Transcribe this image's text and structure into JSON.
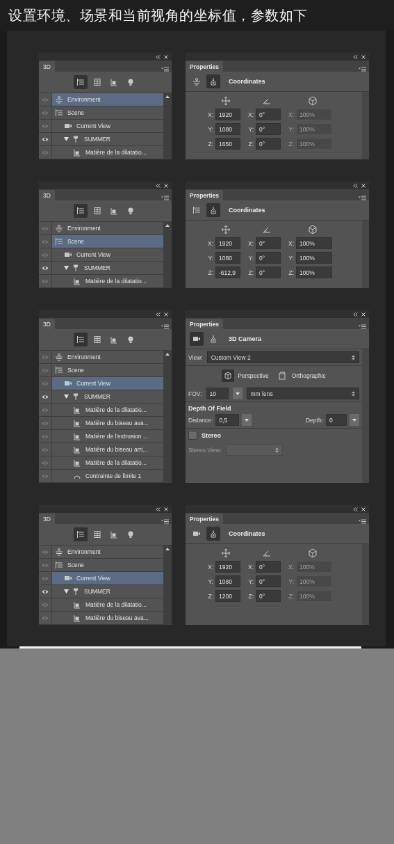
{
  "caption": "设置环境、场景和当前视角的坐标值，参数如下",
  "sections": [
    {
      "layers": {
        "tab": "3D",
        "filters": [
          {
            "kind": "scene",
            "selected": true
          },
          {
            "kind": "mesh",
            "selected": false
          },
          {
            "kind": "material",
            "selected": false
          },
          {
            "kind": "light",
            "selected": false
          }
        ],
        "rows": [
          {
            "kind": "environment",
            "label": "Environment",
            "visible": false,
            "selected": true
          },
          {
            "kind": "scene",
            "label": "Scene",
            "visible": false,
            "selected": false,
            "children": [
              {
                "kind": "camera",
                "label": "Current View",
                "visible": false,
                "selected": false
              },
              {
                "kind": "mesh",
                "label": "SUMMER",
                "visible": true,
                "selected": false,
                "expanded": true,
                "children": [
                  {
                    "kind": "material",
                    "label": "Matière de la dilatatio...",
                    "visible": false,
                    "selected": false
                  }
                ]
              }
            ]
          }
        ]
      },
      "properties": {
        "tab": "Properties",
        "kind": "coordinates",
        "title": "Coordinates",
        "modes": [
          {
            "kind": "environment",
            "selected": false
          },
          {
            "kind": "coordinates",
            "selected": true
          }
        ],
        "rows": [
          {
            "cells": [
              {
                "label": "X:",
                "value": "1920",
                "disabled": false
              },
              {
                "label": "X:",
                "value": "0°",
                "disabled": false
              },
              {
                "label": "X:",
                "value": "100%",
                "disabled": true
              }
            ]
          },
          {
            "cells": [
              {
                "label": "Y:",
                "value": "1080",
                "disabled": false
              },
              {
                "label": "Y:",
                "value": "0°",
                "disabled": false
              },
              {
                "label": "Y:",
                "value": "100%",
                "disabled": true
              }
            ]
          },
          {
            "cells": [
              {
                "label": "Z:",
                "value": "1650",
                "disabled": false
              },
              {
                "label": "Z:",
                "value": "0°",
                "disabled": false
              },
              {
                "label": "Z:",
                "value": "100%",
                "disabled": true
              }
            ]
          }
        ]
      }
    },
    {
      "layers": {
        "tab": "3D",
        "filters": [
          {
            "kind": "scene",
            "selected": true
          },
          {
            "kind": "mesh",
            "selected": false
          },
          {
            "kind": "material",
            "selected": false
          },
          {
            "kind": "light",
            "selected": false
          }
        ],
        "rows": [
          {
            "kind": "environment",
            "label": "Environment",
            "visible": false,
            "selected": false
          },
          {
            "kind": "scene",
            "label": "Scene",
            "visible": false,
            "selected": true,
            "children": [
              {
                "kind": "camera",
                "label": "Current View",
                "visible": false,
                "selected": false
              },
              {
                "kind": "mesh",
                "label": "SUMMER",
                "visible": true,
                "selected": false,
                "expanded": true,
                "children": [
                  {
                    "kind": "material",
                    "label": "Matière de la dilatatio...",
                    "visible": false,
                    "selected": false
                  }
                ]
              }
            ]
          }
        ]
      },
      "properties": {
        "tab": "Properties",
        "kind": "coordinates",
        "title": "Coordinates",
        "modes": [
          {
            "kind": "scene",
            "selected": false
          },
          {
            "kind": "coordinates",
            "selected": true
          }
        ],
        "rows": [
          {
            "cells": [
              {
                "label": "X:",
                "value": "1920",
                "disabled": false
              },
              {
                "label": "X:",
                "value": "0°",
                "disabled": false
              },
              {
                "label": "X:",
                "value": "100%",
                "disabled": false
              }
            ]
          },
          {
            "cells": [
              {
                "label": "Y:",
                "value": "1080",
                "disabled": false
              },
              {
                "label": "Y:",
                "value": "0°",
                "disabled": false
              },
              {
                "label": "Y:",
                "value": "100%",
                "disabled": false
              }
            ]
          },
          {
            "cells": [
              {
                "label": "Z:",
                "value": "-612,9",
                "disabled": false
              },
              {
                "label": "Z:",
                "value": "0°",
                "disabled": false
              },
              {
                "label": "Z:",
                "value": "100%",
                "disabled": false
              }
            ]
          }
        ]
      }
    },
    {
      "layers": {
        "tab": "3D",
        "filters": [
          {
            "kind": "scene",
            "selected": true
          },
          {
            "kind": "mesh",
            "selected": false
          },
          {
            "kind": "material",
            "selected": false
          },
          {
            "kind": "light",
            "selected": false
          }
        ],
        "rows": [
          {
            "kind": "environment",
            "label": "Environment",
            "visible": false,
            "selected": false
          },
          {
            "kind": "scene",
            "label": "Scene",
            "visible": false,
            "selected": false,
            "children": [
              {
                "kind": "camera",
                "label": "Current View",
                "visible": false,
                "selected": true
              },
              {
                "kind": "mesh",
                "label": "SUMMER",
                "visible": true,
                "selected": false,
                "expanded": true,
                "children": [
                  {
                    "kind": "material",
                    "label": "Matière de la dilatatio...",
                    "visible": false,
                    "selected": false
                  },
                  {
                    "kind": "material",
                    "label": "Matière du biseau ava...",
                    "visible": false,
                    "selected": false
                  },
                  {
                    "kind": "material",
                    "label": "Matière de l'extrusion ...",
                    "visible": false,
                    "selected": false
                  },
                  {
                    "kind": "material",
                    "label": "Matière du biseau arri...",
                    "visible": false,
                    "selected": false
                  },
                  {
                    "kind": "material",
                    "label": "Matière de la dilatatio...",
                    "visible": false,
                    "selected": false
                  },
                  {
                    "kind": "constraint",
                    "label": "Contrainte de limite 1",
                    "visible": false,
                    "selected": false
                  }
                ]
              }
            ]
          }
        ]
      },
      "properties": {
        "tab": "Properties",
        "kind": "camera",
        "title": "3D Camera",
        "modes": [
          {
            "kind": "camera",
            "selected": true
          },
          {
            "kind": "coordinates",
            "selected": false
          }
        ],
        "view": {
          "label": "View:",
          "value": "Custom View 2"
        },
        "projections": [
          {
            "kind": "perspective",
            "label": "Perspective",
            "selected": true
          },
          {
            "kind": "orthographic",
            "label": "Orthographic",
            "selected": false
          }
        ],
        "fov": {
          "label": "FOV:",
          "value": "10",
          "lens": "mm lens"
        },
        "dof": {
          "heading": "Depth Of Field",
          "distance": {
            "label": "Distance:",
            "value": "0,5"
          },
          "depth": {
            "label": "Depth:",
            "value": "0"
          }
        },
        "stereo": {
          "label": "Stereo",
          "checked": false,
          "view_label": "Stereo View:",
          "view_disabled": true
        }
      }
    },
    {
      "layers": {
        "tab": "3D",
        "filters": [
          {
            "kind": "scene",
            "selected": true
          },
          {
            "kind": "mesh",
            "selected": false
          },
          {
            "kind": "material",
            "selected": false
          },
          {
            "kind": "light",
            "selected": false
          }
        ],
        "rows": [
          {
            "kind": "environment",
            "label": "Environment",
            "visible": false,
            "selected": false
          },
          {
            "kind": "scene",
            "label": "Scene",
            "visible": false,
            "selected": false,
            "children": [
              {
                "kind": "camera",
                "label": "Current View",
                "visible": false,
                "selected": true
              },
              {
                "kind": "mesh",
                "label": "SUMMER",
                "visible": true,
                "selected": false,
                "expanded": true,
                "children": [
                  {
                    "kind": "material",
                    "label": "Matière de la dilatatio...",
                    "visible": false,
                    "selected": false
                  },
                  {
                    "kind": "material",
                    "label": "Matière du biseau ava...",
                    "visible": false,
                    "selected": false
                  }
                ]
              }
            ]
          }
        ]
      },
      "properties": {
        "tab": "Properties",
        "kind": "coordinates",
        "title": "Coordinates",
        "modes": [
          {
            "kind": "camera",
            "selected": false
          },
          {
            "kind": "coordinates",
            "selected": true
          }
        ],
        "rows": [
          {
            "cells": [
              {
                "label": "X:",
                "value": "1920",
                "disabled": false
              },
              {
                "label": "X:",
                "value": "0°",
                "disabled": false
              },
              {
                "label": "X:",
                "value": "100%",
                "disabled": true
              }
            ]
          },
          {
            "cells": [
              {
                "label": "Y:",
                "value": "1080",
                "disabled": false
              },
              {
                "label": "Y:",
                "value": "0°",
                "disabled": false
              },
              {
                "label": "Y:",
                "value": "100%",
                "disabled": true
              }
            ]
          },
          {
            "cells": [
              {
                "label": "Z:",
                "value": "1200",
                "disabled": false
              },
              {
                "label": "Z:",
                "value": "0°",
                "disabled": false
              },
              {
                "label": "Z:",
                "value": "100%",
                "disabled": true
              }
            ]
          }
        ]
      }
    }
  ]
}
